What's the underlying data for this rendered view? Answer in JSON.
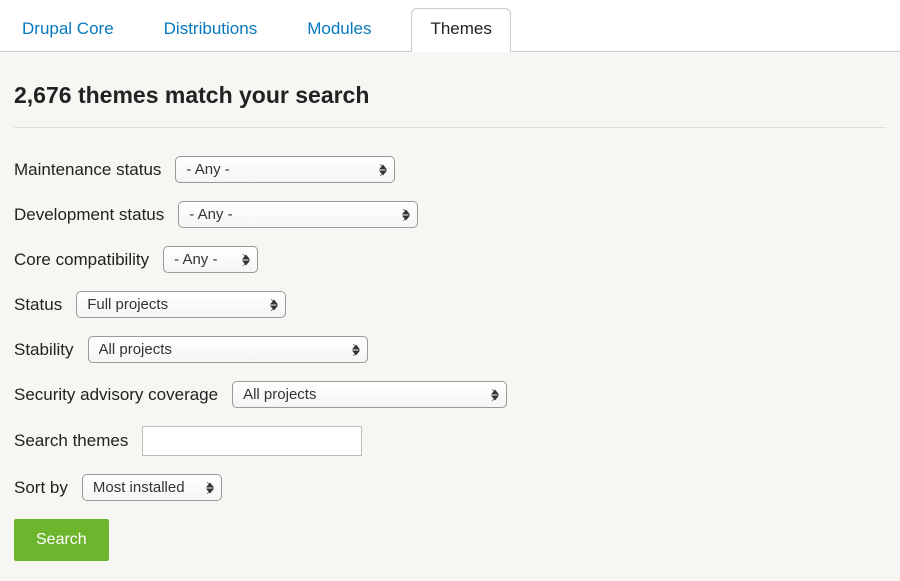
{
  "tabs": [
    {
      "label": "Drupal Core",
      "active": false
    },
    {
      "label": "Distributions",
      "active": false
    },
    {
      "label": "Modules",
      "active": false
    },
    {
      "label": "Themes",
      "active": true
    }
  ],
  "heading": "2,676 themes match your search",
  "filters": {
    "maintenance_status": {
      "label": "Maintenance status",
      "value": "- Any -"
    },
    "development_status": {
      "label": "Development status",
      "value": "- Any -"
    },
    "core_compatibility": {
      "label": "Core compatibility",
      "value": "- Any -"
    },
    "status": {
      "label": "Status",
      "value": "Full projects"
    },
    "stability": {
      "label": "Stability",
      "value": "All projects"
    },
    "security_coverage": {
      "label": "Security advisory coverage",
      "value": "All projects"
    },
    "search_themes": {
      "label": "Search themes",
      "value": ""
    },
    "sort_by": {
      "label": "Sort by",
      "value": "Most installed"
    }
  },
  "search_button": "Search"
}
